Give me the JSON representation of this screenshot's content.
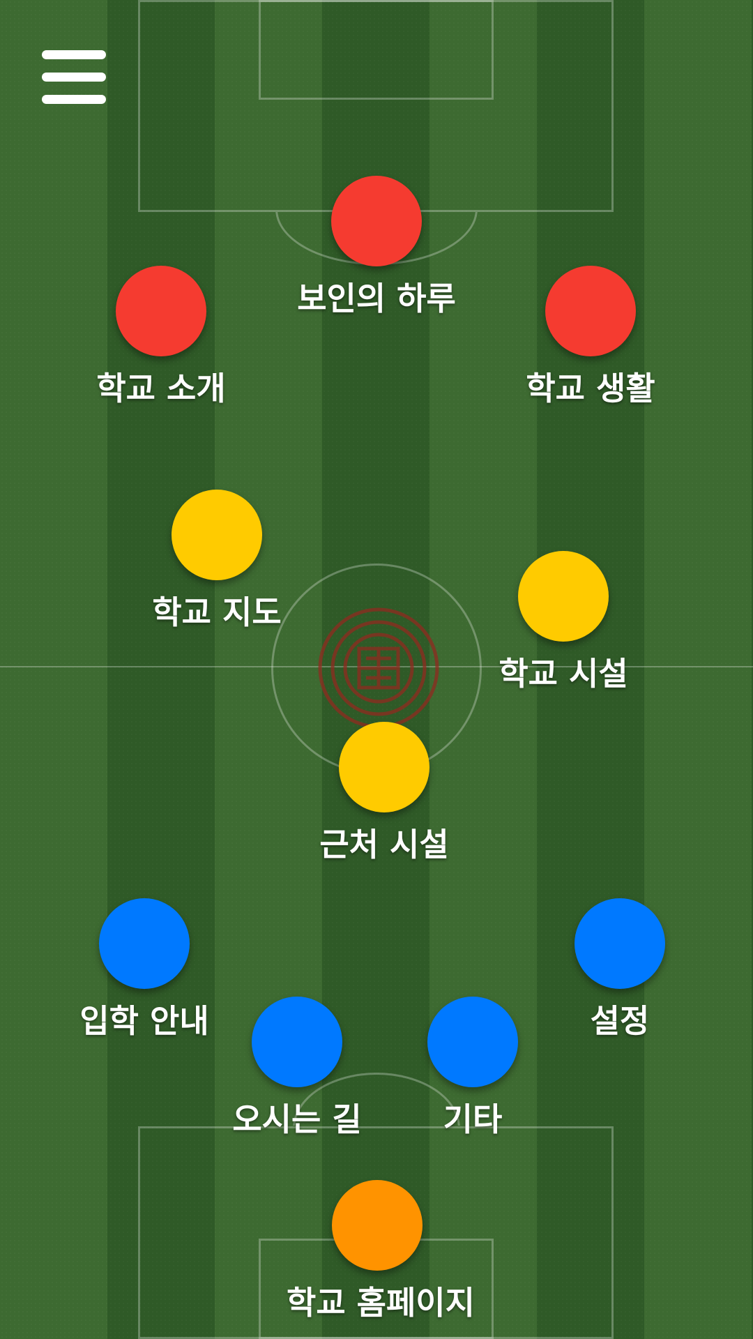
{
  "menu": {
    "icon": "hamburger-menu-icon"
  },
  "colors": {
    "red": "#f53b30",
    "yellow": "#ffcb00",
    "blue": "#0079ff",
    "orange": "#ff9300",
    "field_light": "#3d6a31",
    "field_dark": "#2f5a27"
  },
  "emblem": {
    "icon": "school-emblem-icon"
  },
  "nodes": [
    {
      "label": "보인의 하루",
      "color": "red"
    },
    {
      "label": "학교 소개",
      "color": "red"
    },
    {
      "label": "학교 생활",
      "color": "red"
    },
    {
      "label": "학교 지도",
      "color": "yellow"
    },
    {
      "label": "학교 시설",
      "color": "yellow"
    },
    {
      "label": "근처 시설",
      "color": "yellow"
    },
    {
      "label": "입학 안내",
      "color": "blue"
    },
    {
      "label": "설정",
      "color": "blue"
    },
    {
      "label": "오시는 길",
      "color": "blue"
    },
    {
      "label": "기타",
      "color": "blue"
    },
    {
      "label": "학교 홈페이지",
      "color": "orange"
    }
  ]
}
